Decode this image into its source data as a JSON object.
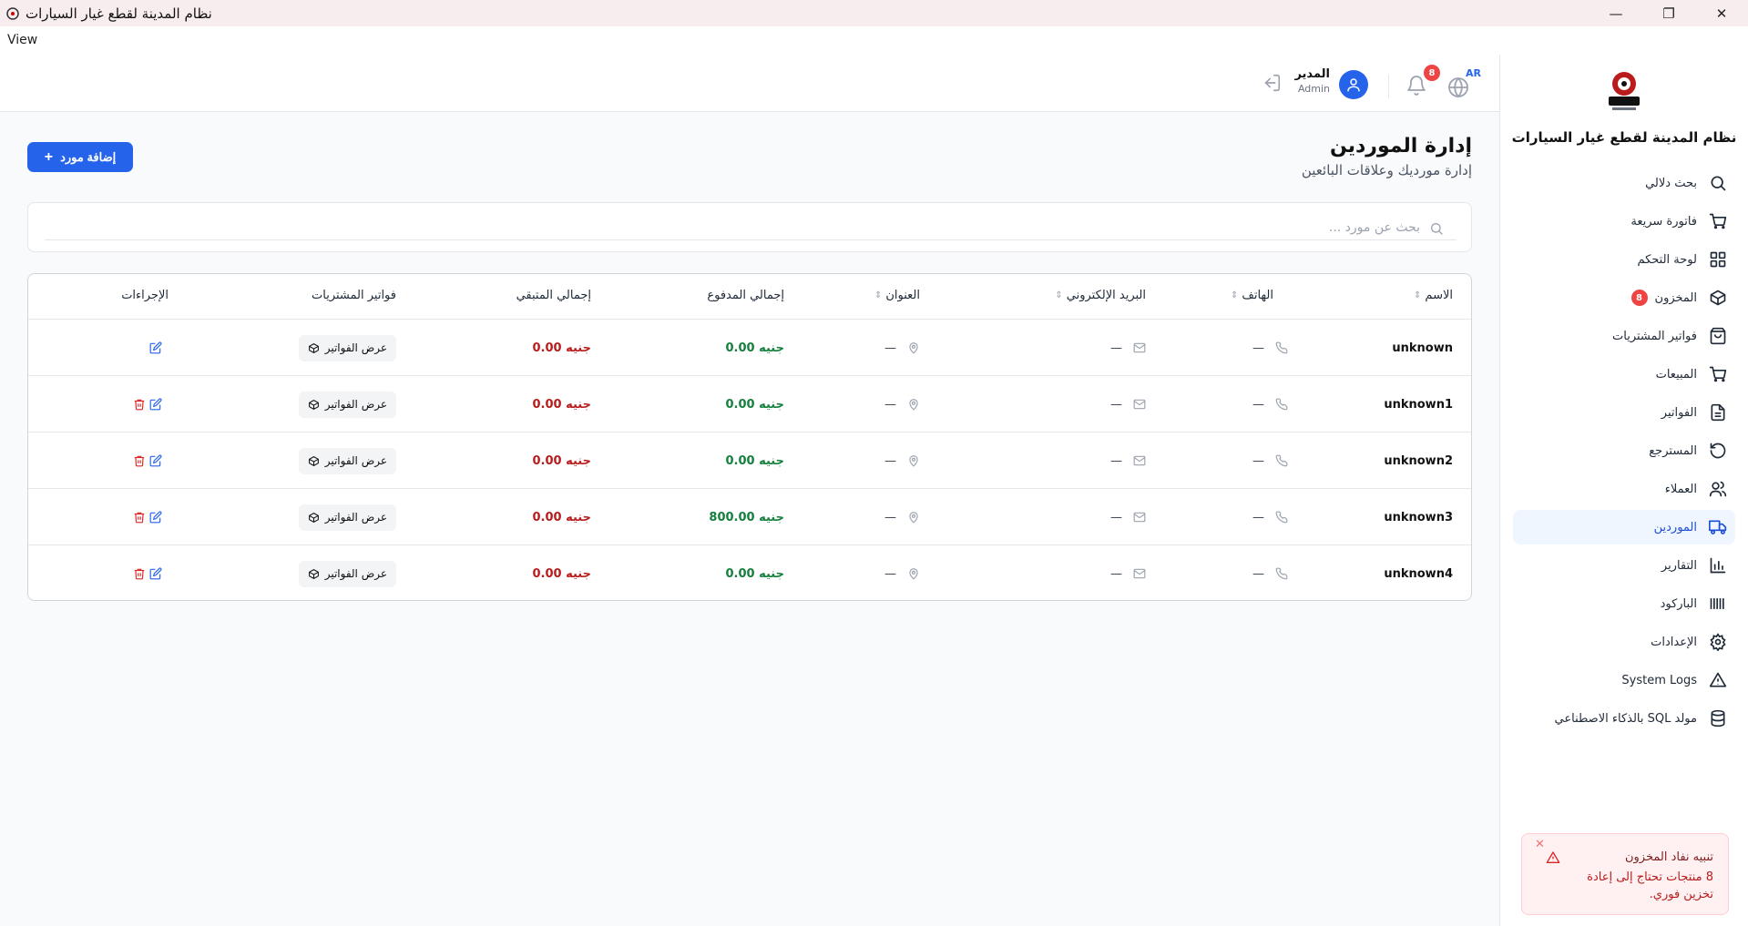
{
  "window": {
    "title": "نظام المدينة لقطع غيار السيارات",
    "menu_view": "View"
  },
  "sidebar": {
    "brand_name": "نظام المدينة لقطع غيار السيارات",
    "logo_text": "المدينة",
    "items": [
      {
        "label": "بحث دلالي",
        "icon": "search-icon"
      },
      {
        "label": "فاتورة سريعة",
        "icon": "cart-icon"
      },
      {
        "label": "لوحة التحكم",
        "icon": "dashboard-icon"
      },
      {
        "label": "المخزون",
        "icon": "box-icon",
        "badge": "8"
      },
      {
        "label": "فواتير المشتريات",
        "icon": "shopping-bag-icon"
      },
      {
        "label": "المبيعات",
        "icon": "cart-icon"
      },
      {
        "label": "الفواتير",
        "icon": "file-icon"
      },
      {
        "label": "المسترجع",
        "icon": "undo-icon"
      },
      {
        "label": "العملاء",
        "icon": "users-icon"
      },
      {
        "label": "الموردين",
        "icon": "truck-icon",
        "active": true
      },
      {
        "label": "التقارير",
        "icon": "bar-chart-icon"
      },
      {
        "label": "الباركود",
        "icon": "barcode-icon"
      },
      {
        "label": "الإعدادات",
        "icon": "gear-icon"
      },
      {
        "label": "System Logs",
        "icon": "warning-icon"
      },
      {
        "label": "مولد SQL بالذكاء الاصطناعي",
        "icon": "database-icon"
      }
    ]
  },
  "header": {
    "lang": "AR",
    "notification_count": "8",
    "user_name": "المدير",
    "user_role": "Admin"
  },
  "page": {
    "title": "إدارة الموردين",
    "subtitle": "إدارة مورديك وعلاقات البائعين",
    "add_button": "إضافة مورد",
    "search_placeholder": "بحث عن مورد ..."
  },
  "table": {
    "columns": {
      "name": "الاسم",
      "phone": "الهاتف",
      "email": "البريد الإلكتروني",
      "address": "العنوان",
      "paid": "إجمالي المدفوع",
      "remaining": "إجمالي المتبقي",
      "invoices": "فواتير المشتريات",
      "actions": "الإجراءات"
    },
    "rows": [
      {
        "name": "unknown",
        "phone": "—",
        "email": "—",
        "address": "—",
        "paid": "جنيه 0.00",
        "remaining": "جنيه 0.00",
        "invoices_btn": "عرض الفواتير",
        "deletable": false
      },
      {
        "name": "unknown1",
        "phone": "—",
        "email": "—",
        "address": "—",
        "paid": "جنيه 0.00",
        "remaining": "جنيه 0.00",
        "invoices_btn": "عرض الفواتير",
        "deletable": true
      },
      {
        "name": "unknown2",
        "phone": "—",
        "email": "—",
        "address": "—",
        "paid": "جنيه 0.00",
        "remaining": "جنيه 0.00",
        "invoices_btn": "عرض الفواتير",
        "deletable": true
      },
      {
        "name": "unknown3",
        "phone": "—",
        "email": "—",
        "address": "—",
        "paid": "جنيه 800.00",
        "remaining": "جنيه 0.00",
        "invoices_btn": "عرض الفواتير",
        "deletable": true
      },
      {
        "name": "unknown4",
        "phone": "—",
        "email": "—",
        "address": "—",
        "paid": "جنيه 0.00",
        "remaining": "جنيه 0.00",
        "invoices_btn": "عرض الفواتير",
        "deletable": true
      }
    ]
  },
  "toast": {
    "title": "تنبيه نفاد المخزون",
    "message": "8 منتجات تحتاج إلى إعادة تخزين فوري."
  },
  "colors": {
    "accent": "#2563eb",
    "danger": "#ef4444",
    "paid": "#15803d",
    "remaining": "#b91c1c"
  }
}
